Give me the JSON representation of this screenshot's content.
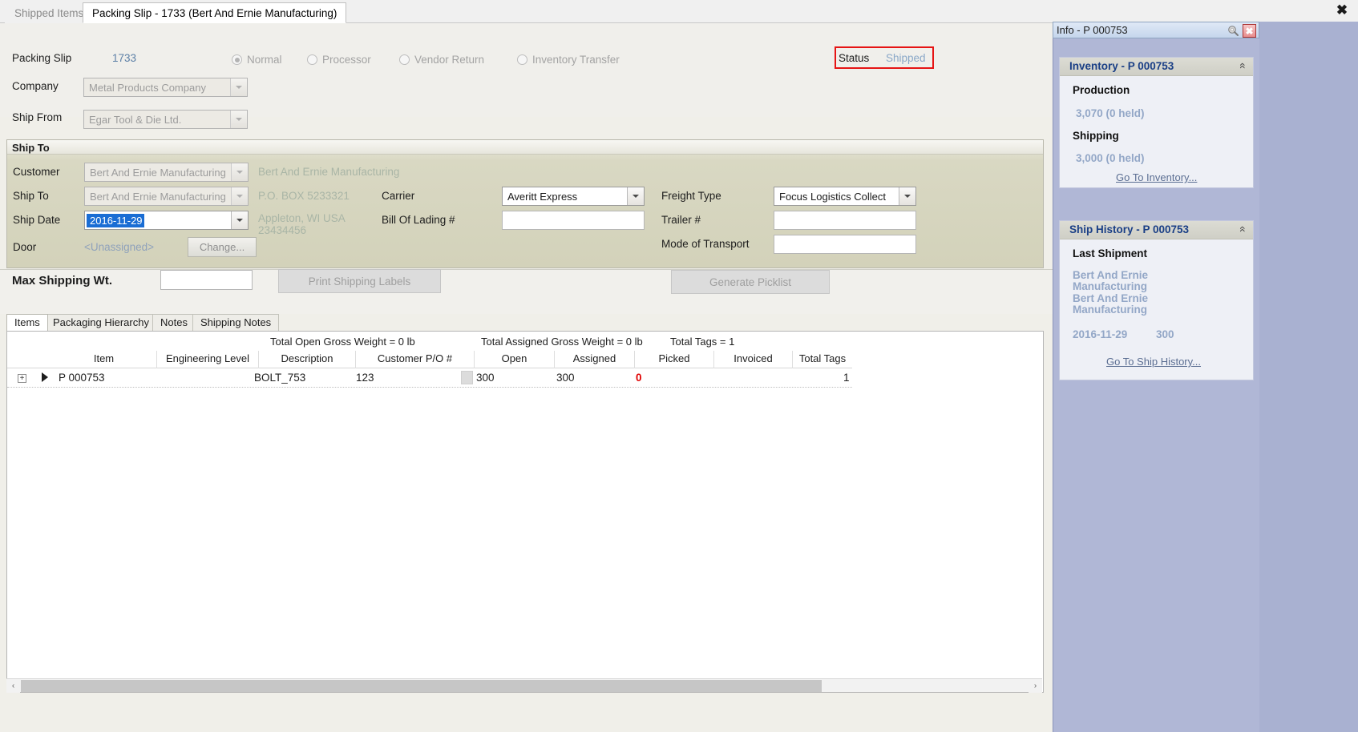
{
  "window": {
    "close_glyph": "✖"
  },
  "tabs": [
    {
      "label": "Shipped Items",
      "active": false
    },
    {
      "label": "Packing Slip - 1733 (Bert And Ernie Manufacturing)",
      "active": true
    }
  ],
  "header": {
    "packing_slip_label": "Packing Slip",
    "packing_slip_value": "1733",
    "company_label": "Company",
    "company_value": "Metal Products Company",
    "ship_from_label": "Ship From",
    "ship_from_value": "Egar Tool & Die Ltd.",
    "types": [
      {
        "label": "Normal",
        "selected": true
      },
      {
        "label": "Processor",
        "selected": false
      },
      {
        "label": "Vendor Return",
        "selected": false
      },
      {
        "label": "Inventory Transfer",
        "selected": false
      }
    ],
    "status_label": "Status",
    "status_value": "Shipped",
    "status_highlight_color": "#e61414"
  },
  "ship_to": {
    "group_title": "Ship To",
    "customer_label": "Customer",
    "customer_value": "Bert And Ernie Manufacturing",
    "customer_display": "Bert And Ernie Manufacturing",
    "ship_to_label": "Ship To",
    "ship_to_value": "Bert And Ernie Manufacturing",
    "address_line1": "P.O. BOX 5233321",
    "address_line2": "Appleton, WI USA",
    "address_line3": "23434456",
    "ship_date_label": "Ship Date",
    "ship_date_value": "2016-11-29",
    "door_label": "Door",
    "door_value": "<Unassigned>",
    "change_button": "Change...",
    "carrier_label": "Carrier",
    "carrier_value": "Averitt Express",
    "bol_label": "Bill Of Lading #",
    "bol_value": "",
    "freight_type_label": "Freight Type",
    "freight_type_value": "Focus Logistics Collect",
    "trailer_label": "Trailer #",
    "trailer_value": "",
    "mode_label": "Mode of Transport",
    "mode_value": ""
  },
  "actions": {
    "max_shipping_wt_label": "Max Shipping Wt.",
    "max_shipping_wt_value": "",
    "print_labels_button": "Print Shipping Labels",
    "generate_picklist_button": "Generate Picklist"
  },
  "lower_tabs": [
    {
      "label": "Items",
      "active": true
    },
    {
      "label": "Packaging Hierarchy",
      "active": false
    },
    {
      "label": "Notes",
      "active": false
    },
    {
      "label": "Shipping Notes",
      "active": false
    }
  ],
  "grid": {
    "totals": [
      "Total Open Gross Weight = 0 lb",
      "Total Assigned Gross Weight = 0 lb",
      "Total Tags = 1"
    ],
    "columns": [
      "Item",
      "Engineering Level",
      "Description",
      "Customer P/O #",
      "Open",
      "Assigned",
      "Picked",
      "Invoiced",
      "Total Tags"
    ],
    "rows": [
      {
        "expander": "+",
        "item": "P 000753",
        "engineering_level": "",
        "description": "BOLT_753",
        "customer_po": "123",
        "open": "300",
        "assigned": "300",
        "picked": "0",
        "invoiced": "",
        "total_tags": "1"
      }
    ],
    "scroll_left_glyph": "‹",
    "scroll_right_glyph": "›"
  },
  "dock": {
    "title": "Info - P 000753",
    "pin_icon": "pin-icon",
    "close_glyph": "✖",
    "inventory": {
      "title": "Inventory - P 000753",
      "collapse_glyph": "«",
      "production_label": "Production",
      "production_value": "3,070 (0 held)",
      "shipping_label": "Shipping",
      "shipping_value": "3,000 (0 held)",
      "link": "Go To Inventory..."
    },
    "ship_history": {
      "title": "Ship History - P 000753",
      "collapse_glyph": "«",
      "last_shipment_label": "Last Shipment",
      "customer_line1": "Bert And Ernie",
      "customer_line2": "Manufacturing",
      "customer_line3": "Bert And Ernie",
      "customer_line4": "Manufacturing",
      "date": "2016-11-29",
      "qty": "300",
      "link": "Go To Ship History..."
    }
  }
}
